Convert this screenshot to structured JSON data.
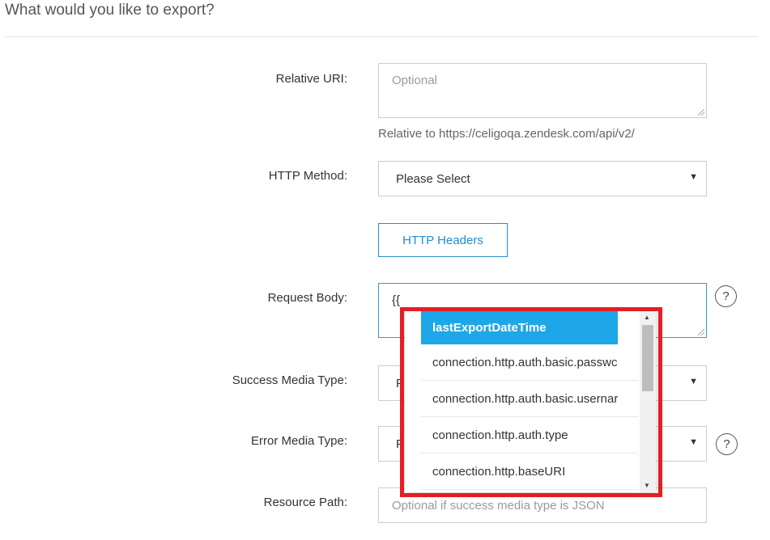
{
  "section_title": "What would you like to export?",
  "fields": {
    "relative_uri": {
      "label": "Relative URI:",
      "placeholder": "Optional",
      "help": "Relative to https://celigoqa.zendesk.com/api/v2/"
    },
    "http_method": {
      "label": "HTTP Method:",
      "value": "Please Select"
    },
    "http_headers_button": "HTTP Headers",
    "request_body": {
      "label": "Request Body:",
      "value": "{{"
    },
    "success_media_type": {
      "label": "Success Media Type:",
      "value": "P"
    },
    "error_media_type": {
      "label": "Error Media Type:",
      "value": "P"
    },
    "resource_path": {
      "label": "Resource Path:",
      "placeholder": "Optional if success media type is JSON"
    }
  },
  "help_glyph": "?",
  "caret_glyph": "▼",
  "autocomplete": {
    "items": [
      "lastExportDateTime",
      "connection.http.auth.basic.passwc",
      "connection.http.auth.basic.usernar",
      "connection.http.auth.type",
      "connection.http.baseURI"
    ],
    "active_index": 0,
    "highlight_color": "#e41e26",
    "active_color": "#1ea7e8"
  }
}
